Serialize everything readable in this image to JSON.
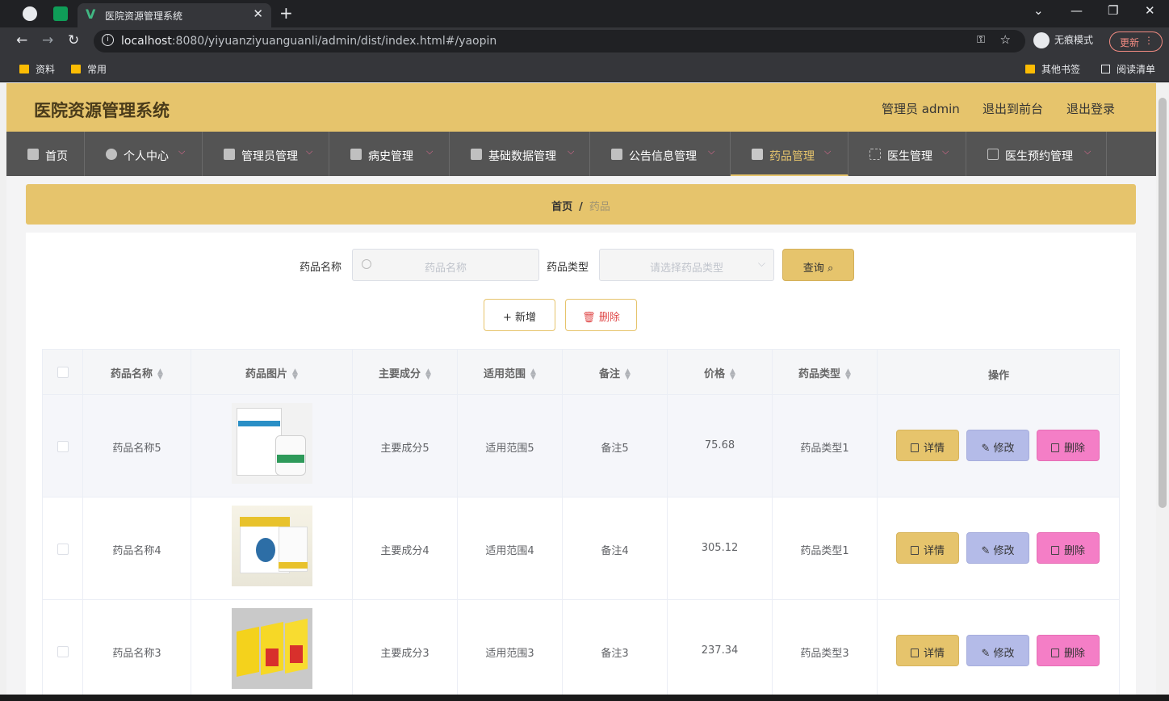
{
  "browser": {
    "active_tab_title": "医院资源管理系统",
    "url_host": "localhost",
    "url_rest": ":8080/yiyuanziyuanguanli/admin/dist/index.html#/yaopin",
    "incognito_label": "无痕模式",
    "update_label": "更新",
    "bookmarks": [
      "资料",
      "常用"
    ],
    "other_bookmarks": "其他书签",
    "reading_list": "阅读清单"
  },
  "header": {
    "title": "医院资源管理系统",
    "user_label": "管理员 admin",
    "front_link": "退出到前台",
    "logout_link": "退出登录"
  },
  "menu": [
    {
      "label": "首页",
      "has_children": false
    },
    {
      "label": "个人中心",
      "has_children": true
    },
    {
      "label": "管理员管理",
      "has_children": true
    },
    {
      "label": "病史管理",
      "has_children": true
    },
    {
      "label": "基础数据管理",
      "has_children": true
    },
    {
      "label": "公告信息管理",
      "has_children": true
    },
    {
      "label": "药品管理",
      "has_children": true,
      "active": true
    },
    {
      "label": "医生管理",
      "has_children": true
    },
    {
      "label": "医生预约管理",
      "has_children": true
    }
  ],
  "breadcrumb": {
    "home": "首页",
    "separator": "/",
    "current": "药品"
  },
  "search": {
    "name_label": "药品名称",
    "name_placeholder": "药品名称",
    "type_label": "药品类型",
    "type_placeholder": "请选择药品类型",
    "query_button": "查询"
  },
  "actions": {
    "add": "新增",
    "delete": "删除"
  },
  "table": {
    "columns": [
      "药品名称",
      "药品图片",
      "主要成分",
      "适用范围",
      "备注",
      "价格",
      "药品类型",
      "操作"
    ],
    "rows": [
      {
        "name": "药品名称5",
        "ingredient": "主要成分5",
        "scope": "适用范围5",
        "note": "备注5",
        "price": "75.68",
        "type": "药品类型1"
      },
      {
        "name": "药品名称4",
        "ingredient": "主要成分4",
        "scope": "适用范围4",
        "note": "备注4",
        "price": "305.12",
        "type": "药品类型1"
      },
      {
        "name": "药品名称3",
        "ingredient": "主要成分3",
        "scope": "适用范围3",
        "note": "备注3",
        "price": "237.34",
        "type": "药品类型3"
      }
    ],
    "op_labels": {
      "detail": "详情",
      "edit": "修改",
      "delete": "删除"
    }
  },
  "colors": {
    "accent": "#e6c46c",
    "menu_bg": "#545454",
    "edit": "#b4bbe8",
    "delete": "#f47ec6"
  }
}
